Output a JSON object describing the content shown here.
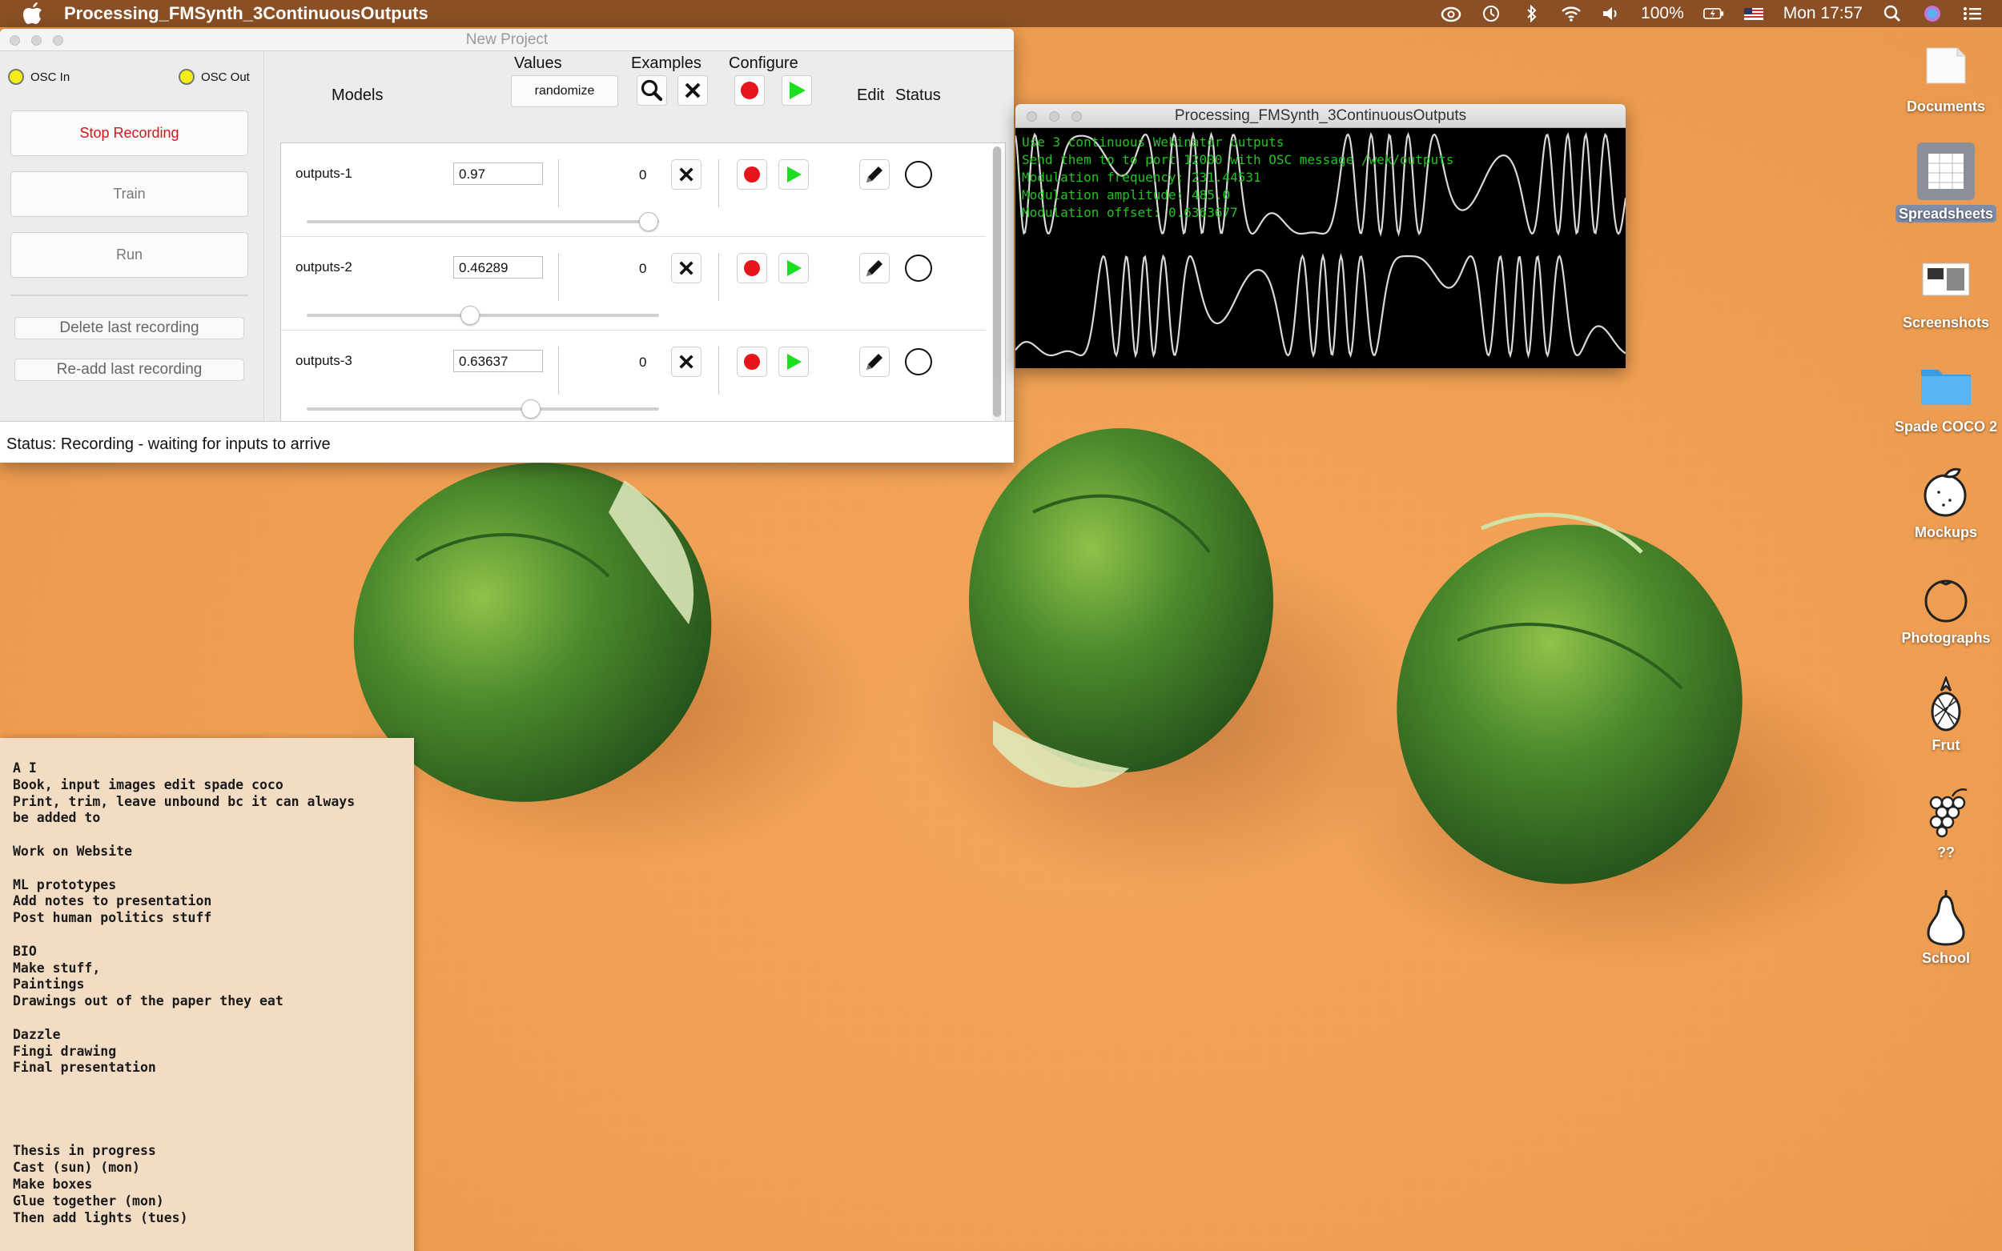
{
  "menubar": {
    "app_name": "Processing_FMSynth_3ContinuousOutputs",
    "battery": "100%",
    "clock": "Mon 17:57",
    "icons": [
      "creative-cloud-icon",
      "time-machine-icon",
      "bluetooth-icon",
      "wifi-icon",
      "volume-icon",
      "battery-icon",
      "us-flag-icon",
      "spotlight-icon",
      "siri-icon",
      "notification-center-icon"
    ]
  },
  "wekinator": {
    "title": "New Project",
    "osc_in": "OSC In",
    "osc_out": "OSC Out",
    "stop_recording": "Stop Recording",
    "train": "Train",
    "run": "Run",
    "delete_last": "Delete last recording",
    "readd_last": "Re-add last recording",
    "headers": {
      "models": "Models",
      "values": "Values",
      "examples": "Examples",
      "configure": "Configure",
      "edit": "Edit",
      "status": "Status"
    },
    "randomize": "randomize",
    "rows": [
      {
        "name": "outputs-1",
        "value": "0.97",
        "count": "0",
        "slider": 0.97
      },
      {
        "name": "outputs-2",
        "value": "0.46289",
        "count": "0",
        "slider": 0.46289
      },
      {
        "name": "outputs-3",
        "value": "0.63637",
        "count": "0",
        "slider": 0.63637
      }
    ],
    "status": "Status: Recording - waiting for inputs to arrive"
  },
  "processing": {
    "title": "Processing_FMSynth_3ContinuousOutputs",
    "lines": [
      "Use 3 continuous Wekinator outputs",
      "Send them to to port 12000 with OSC message /wek/outputs",
      "Modulation frequency: 231.44531",
      "Modulation amplitude: 485.0",
      "Modulation offset: 0.6363677"
    ]
  },
  "desktop_icons": [
    {
      "label": "Documents",
      "icon": "document-icon"
    },
    {
      "label": "Spreadsheets",
      "icon": "spreadsheet-icon"
    },
    {
      "label": "Screenshots",
      "icon": "screenshot-icon"
    },
    {
      "label": "Spade COCO 2",
      "icon": "folder-icon"
    },
    {
      "label": "Mockups",
      "icon": "orange-icon"
    },
    {
      "label": "Photographs",
      "icon": "orange-outline-icon"
    },
    {
      "label": "Frut",
      "icon": "pineapple-icon"
    },
    {
      "label": "??",
      "icon": "grapes-icon"
    },
    {
      "label": "School",
      "icon": "pear-icon"
    }
  ],
  "note": {
    "text": "A I\nBook, input images edit spade coco\nPrint, trim, leave unbound bc it can always\nbe added to\n\nWork on Website\n\nML prototypes\nAdd notes to presentation\nPost human politics stuff\n\nBIO\nMake stuff,\nPaintings\nDrawings out of the paper they eat\n\nDazzle\nFingi drawing\nFinal presentation\n\n\n\n\nThesis in progress\nCast (sun) (mon)\nMake boxes\nGlue together (mon)\nThen add lights (tues)"
  },
  "colors": {
    "desktop": "#f0a053",
    "menubar": "#8a4f24",
    "record_red": "#e8141b",
    "play_green": "#19e01f",
    "terminal_green": "#22c322",
    "note": "#f3dcc4"
  }
}
